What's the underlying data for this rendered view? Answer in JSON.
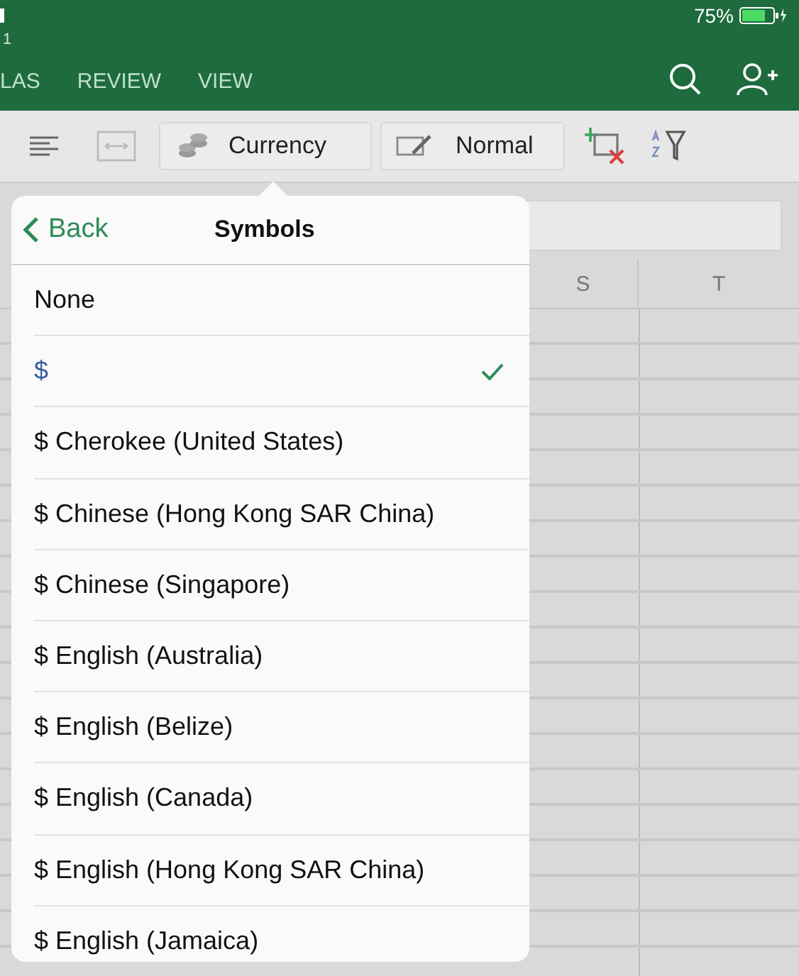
{
  "status_bar": {
    "battery": "75%"
  },
  "window": {
    "title": "1"
  },
  "tabs": [
    {
      "label": "LAS",
      "selected": false
    },
    {
      "label": "REVIEW",
      "selected": false
    },
    {
      "label": "VIEW",
      "selected": false
    }
  ],
  "toolbar": {
    "currency_button": "Currency",
    "style_button": "Normal"
  },
  "sheet": {
    "columns": [
      "S",
      "T"
    ]
  },
  "popover": {
    "back": "Back",
    "title": "Symbols",
    "items": [
      {
        "label": "None",
        "selected": false
      },
      {
        "label": "$",
        "selected": true
      },
      {
        "label": "$ Cherokee (United States)",
        "selected": false
      },
      {
        "label": "$ Chinese (Hong Kong SAR China)",
        "selected": false
      },
      {
        "label": "$ Chinese (Singapore)",
        "selected": false
      },
      {
        "label": "$ English (Australia)",
        "selected": false
      },
      {
        "label": "$ English (Belize)",
        "selected": false
      },
      {
        "label": "$ English (Canada)",
        "selected": false
      },
      {
        "label": "$ English (Hong Kong SAR China)",
        "selected": false
      },
      {
        "label": "$ English (Jamaica)",
        "selected": false
      }
    ]
  }
}
